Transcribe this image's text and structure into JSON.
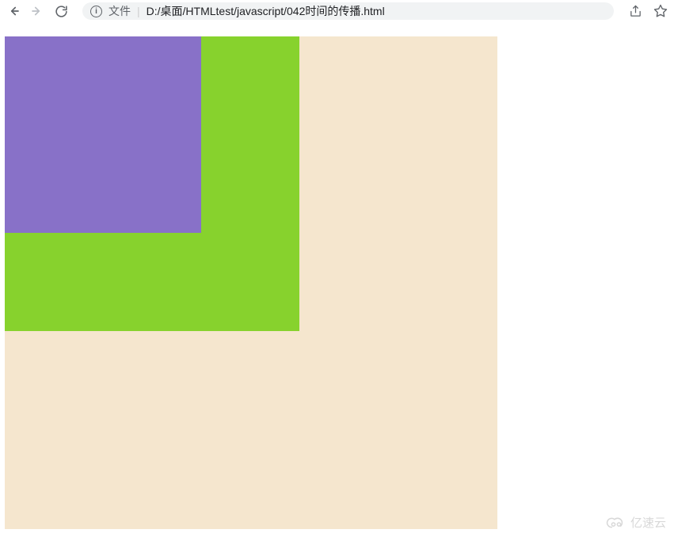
{
  "toolbar": {
    "url_label": "文件",
    "url_path": "D:/桌面/HTMLtest/javascript/042时间的传播.html"
  },
  "boxes": {
    "outer_color": "#f5e6ce",
    "middle_color": "#87d22d",
    "inner_color": "#8871c8"
  },
  "watermark": {
    "text": "亿速云"
  }
}
